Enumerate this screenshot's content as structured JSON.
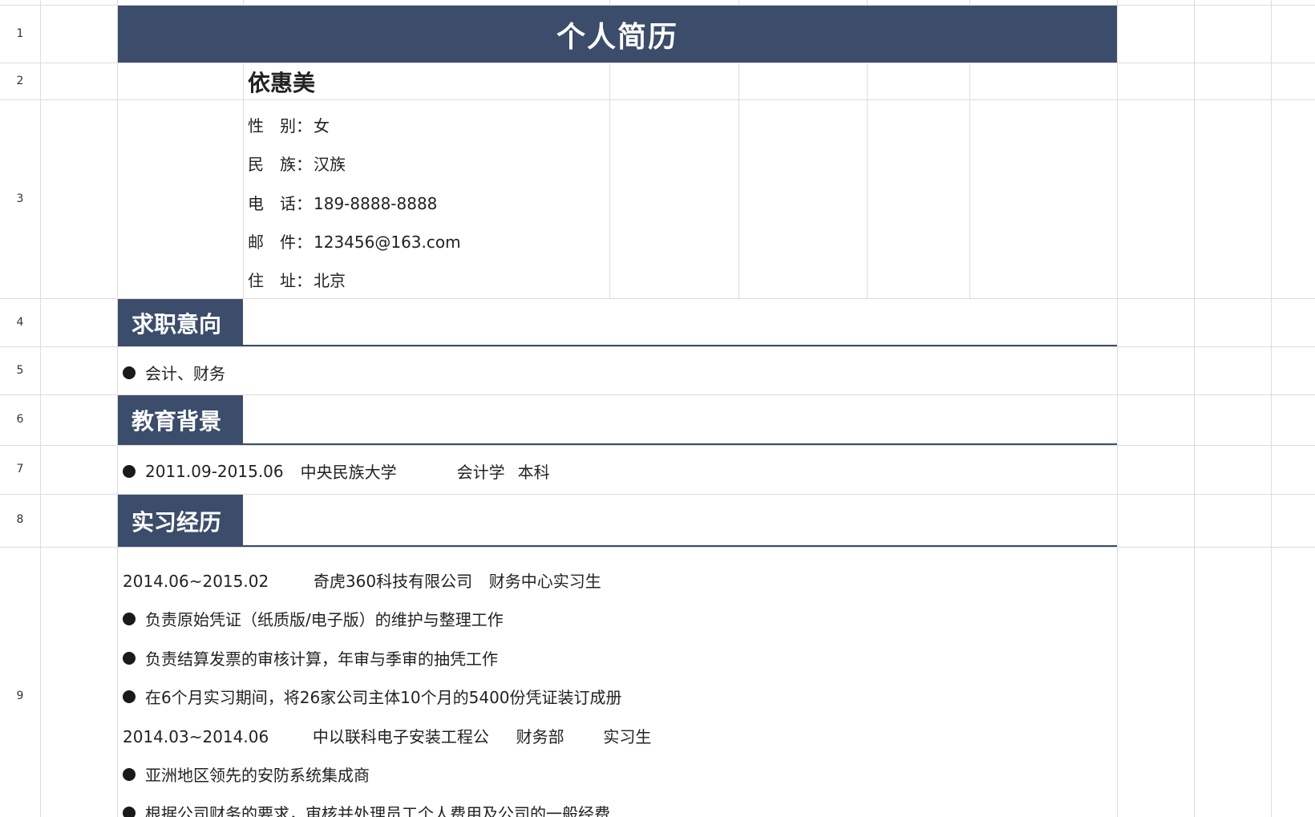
{
  "row_numbers": [
    "1",
    "2",
    "3",
    "4",
    "5",
    "6",
    "7",
    "8",
    "9"
  ],
  "title": "个人简历",
  "name": "依惠美",
  "info": [
    {
      "label": "性　别：",
      "value": "女"
    },
    {
      "label": "民　族：",
      "value": "汉族"
    },
    {
      "label": "电　话：",
      "value": "189-8888-8888"
    },
    {
      "label": "邮　件：",
      "value": "123456@163.com"
    },
    {
      "label": "住　址：",
      "value": "北京"
    }
  ],
  "sections": {
    "intent": {
      "heading": "求职意向",
      "item": "会计、财务"
    },
    "education": {
      "heading": "教育背景",
      "period": "2011.09-2015.06",
      "school": "中央民族大学",
      "major": "会计学",
      "degree": "本科"
    },
    "internship": {
      "heading": "实习经历"
    }
  },
  "internship": {
    "job1": {
      "period": "2014.06~2015.02",
      "company": "奇虎360科技有限公司",
      "role": "财务中心实习生"
    },
    "job1_items": [
      "负责原始凭证（纸质版/电子版）的维护与整理工作",
      "负责结算发票的审核计算，年审与季审的抽凭工作",
      "在6个月实习期间，将26家公司主体10个月的5400份凭证装订成册"
    ],
    "job2": {
      "period": "2014.03~2014.06",
      "company": "中以联科电子安装工程公",
      "dept": "财务部",
      "role": "实习生"
    },
    "job2_items": [
      "亚洲地区领先的安防系统集成商",
      "根据公司财务的要求，审核并处理员工个人费用及公司的一般经费"
    ]
  }
}
